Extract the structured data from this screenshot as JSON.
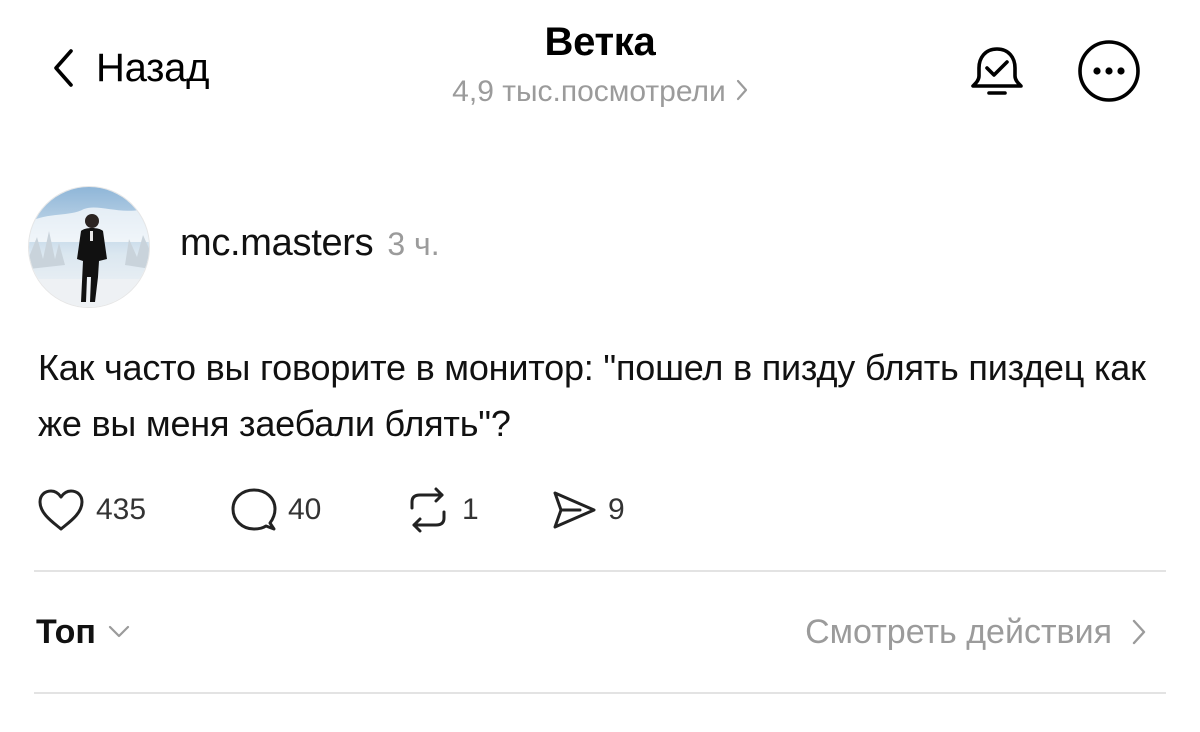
{
  "header": {
    "back_label": "Назад",
    "title": "Ветка",
    "views": "4,9 тыс.посмотрели"
  },
  "icons": {
    "back": "chevron-left-icon",
    "views_chevron": "chevron-right-icon",
    "subscribe": "bell-check-icon",
    "more": "more-horizontal-icon",
    "like": "heart-icon",
    "reply": "comment-icon",
    "repost": "repost-icon",
    "share": "send-icon",
    "sort_chevron": "chevron-down-icon",
    "activity_chevron": "chevron-right-icon"
  },
  "post": {
    "username": "mc.masters",
    "time": "3 ч.",
    "text": "Как часто вы говорите в монитор: \"пошел в пизду блять пиздец как же вы меня заебали блять\"?",
    "likes": "435",
    "replies": "40",
    "reposts": "1",
    "shares": "9"
  },
  "footer": {
    "sort_label": "Топ",
    "activity_label": "Смотреть действия"
  },
  "colors": {
    "text": "#111111",
    "muted": "#9b9b9b",
    "divider": "#e3e3e3",
    "background": "#ffffff"
  }
}
